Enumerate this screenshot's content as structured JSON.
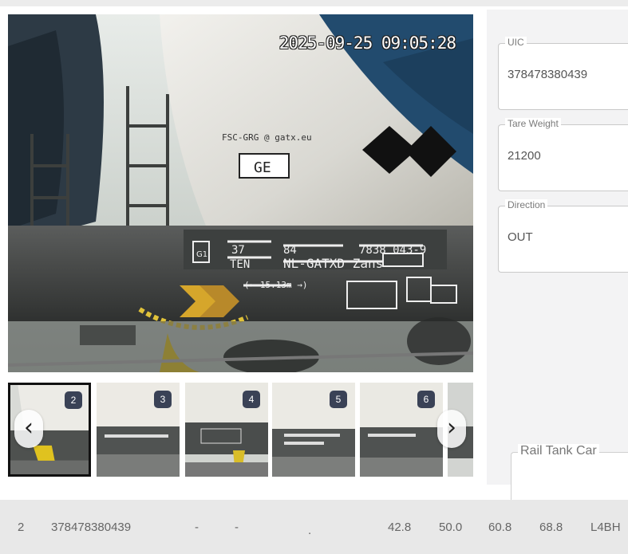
{
  "main_image": {
    "timestamp": "2025-09-25 09:05:28",
    "alt": "Tank wagon side with UIC marking"
  },
  "thumbnails": [
    {
      "index": "2",
      "active": true
    },
    {
      "index": "3",
      "active": false
    },
    {
      "index": "4",
      "active": false
    },
    {
      "index": "5",
      "active": false
    },
    {
      "index": "6",
      "active": false
    }
  ],
  "nav": {
    "prev_icon": "‹",
    "next_icon": "›"
  },
  "fields": {
    "uic": {
      "label": "UIC",
      "value": "378478380439"
    },
    "tare_weight": {
      "label": "Tare Weight",
      "value": "21200"
    },
    "direction": {
      "label": "Direction",
      "value": "OUT"
    }
  },
  "rail_tank_car": {
    "label": "Rail Tank Car"
  },
  "row": {
    "index": "2",
    "uic": "378478380439",
    "col3": "-",
    "col4": "-",
    "col5": ".",
    "val1": "42.8",
    "val2": "50.0",
    "val3": "60.8",
    "val4": "68.8",
    "code": "L4BH"
  },
  "colors": {
    "badge": "#3a4256",
    "panel_bg": "#f3f3f4",
    "row_bg": "#e8e8e8"
  }
}
